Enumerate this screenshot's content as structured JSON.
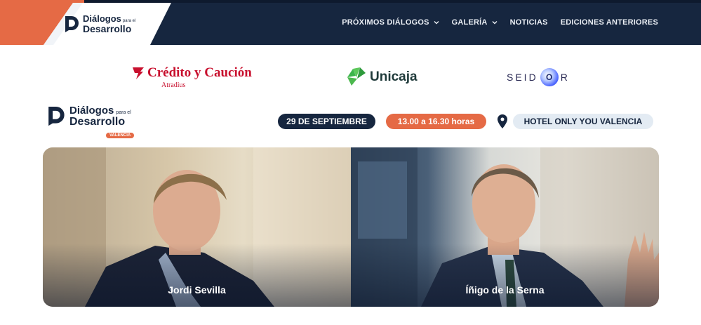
{
  "header": {
    "logo": {
      "line1": "Diálogos",
      "line1_small": "para el",
      "line2": "Desarrollo"
    },
    "nav": [
      {
        "label": "PRÓXIMOS DIÁLOGOS",
        "has_dropdown": true
      },
      {
        "label": "GALERÍA",
        "has_dropdown": true
      },
      {
        "label": "NOTICIAS",
        "has_dropdown": false
      },
      {
        "label": "EDICIONES ANTERIORES",
        "has_dropdown": false
      }
    ]
  },
  "sponsors": {
    "cyc": {
      "name": "Crédito y Caución",
      "sub": "Atradius",
      "color": "#c8102e"
    },
    "unicaja": {
      "name": "Unicaja",
      "color": "#3bb54a"
    },
    "seidor": {
      "pre": "SEID",
      "o": "O",
      "post": "R"
    }
  },
  "event": {
    "logo": {
      "line1": "Diálogos",
      "line1_small": "para el",
      "line2": "Desarrollo",
      "badge": "VALENCIA"
    },
    "date": "29 DE SEPTIEMBRE",
    "time": "13.00 a 16.30 horas",
    "venue": "HOTEL ONLY YOU VALENCIA"
  },
  "speakers": [
    {
      "name": "Jordi Sevilla"
    },
    {
      "name": "Íñigo de la Serna"
    }
  ],
  "colors": {
    "navy": "#16263f",
    "orange": "#e56a45",
    "venue_bg": "#e3ebf3"
  }
}
